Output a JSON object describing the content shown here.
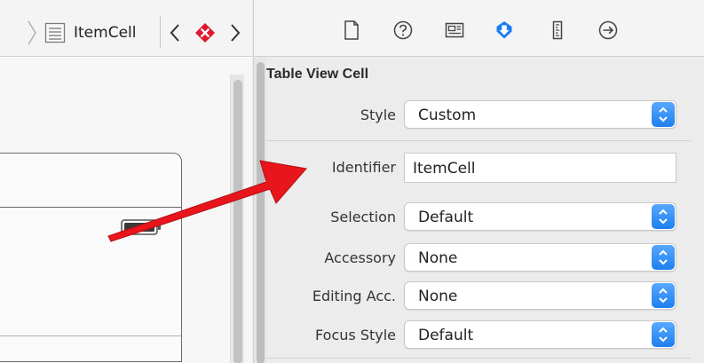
{
  "jumpbar": {
    "item_label": "ItemCell"
  },
  "inspector": {
    "tabs": [
      {
        "name": "file-inspector"
      },
      {
        "name": "quick-help"
      },
      {
        "name": "identity-inspector"
      },
      {
        "name": "attributes-inspector",
        "selected": true
      },
      {
        "name": "size-inspector"
      },
      {
        "name": "connections-inspector"
      }
    ],
    "section_title": "Table View Cell",
    "style": {
      "label": "Style",
      "value": "Custom"
    },
    "identifier": {
      "label": "Identifier",
      "value": "ItemCell"
    },
    "selection": {
      "label": "Selection",
      "value": "Default"
    },
    "accessory": {
      "label": "Accessory",
      "value": "None"
    },
    "editing_acc": {
      "label": "Editing Acc.",
      "value": "None"
    },
    "focus_style": {
      "label": "Focus Style",
      "value": "Default"
    }
  },
  "colors": {
    "accent": "#1a7cf4",
    "error": "#e0182d",
    "arrow": "#e8161c"
  }
}
